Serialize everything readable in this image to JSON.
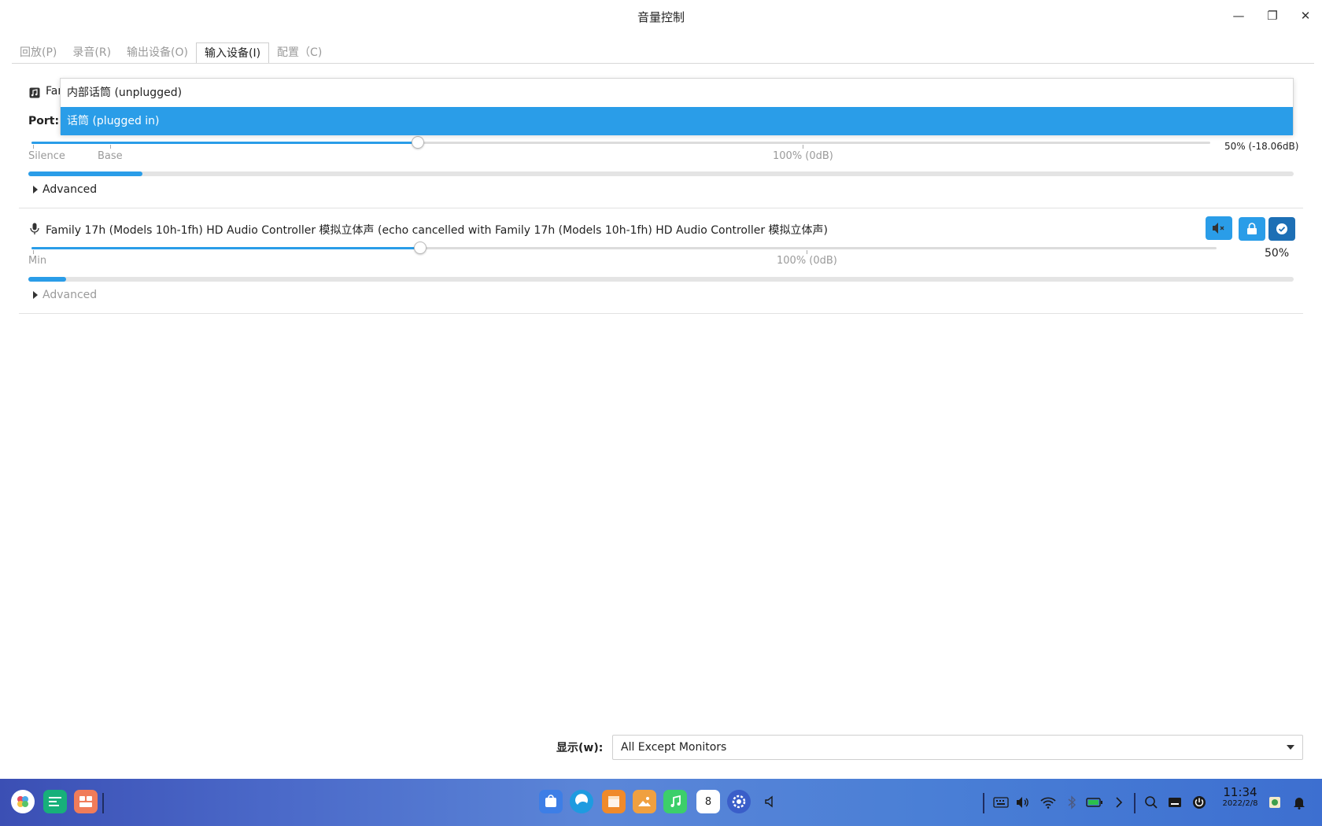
{
  "window": {
    "title": "音量控制",
    "minimize_label": "—",
    "maximize_label": "❐",
    "close_label": "✕"
  },
  "tabs": [
    {
      "label": "回放(P)"
    },
    {
      "label": "录音(R)"
    },
    {
      "label": "输出设备(O)"
    },
    {
      "label": "输入设备(I)"
    },
    {
      "label": "配置（C)"
    }
  ],
  "device1": {
    "title_fragment": "Far",
    "port_label": "Port:",
    "volume_text": "50% (-18.06dB)",
    "volume_fraction": 0.328,
    "level_fraction": 0.09,
    "ticks": {
      "silence": "Silence",
      "base": "Base",
      "full": "100% (0dB)"
    },
    "advanced_label": "Advanced"
  },
  "port_dropdown": {
    "options": [
      "内部话筒 (unplugged)",
      "话筒 (plugged in)"
    ],
    "selected_index": 1
  },
  "device2": {
    "title": "Family 17h (Models 10h-1fh) HD Audio Controller 模拟立体声 (echo cancelled with Family 17h (Models 10h-1fh) HD Audio Controller 模拟立体声)",
    "volume_text": "50%",
    "volume_fraction": 0.328,
    "level_fraction": 0.03,
    "ticks": {
      "min": "Min",
      "full": "100% (0dB)"
    },
    "advanced_label": "Advanced"
  },
  "show": {
    "label": "显示(w):",
    "value": "All Except Monitors"
  },
  "taskbar": {
    "time": "11:34",
    "date": "2022/2/8",
    "calendar_day": "8"
  },
  "colors": {
    "accent": "#2a9de8"
  }
}
